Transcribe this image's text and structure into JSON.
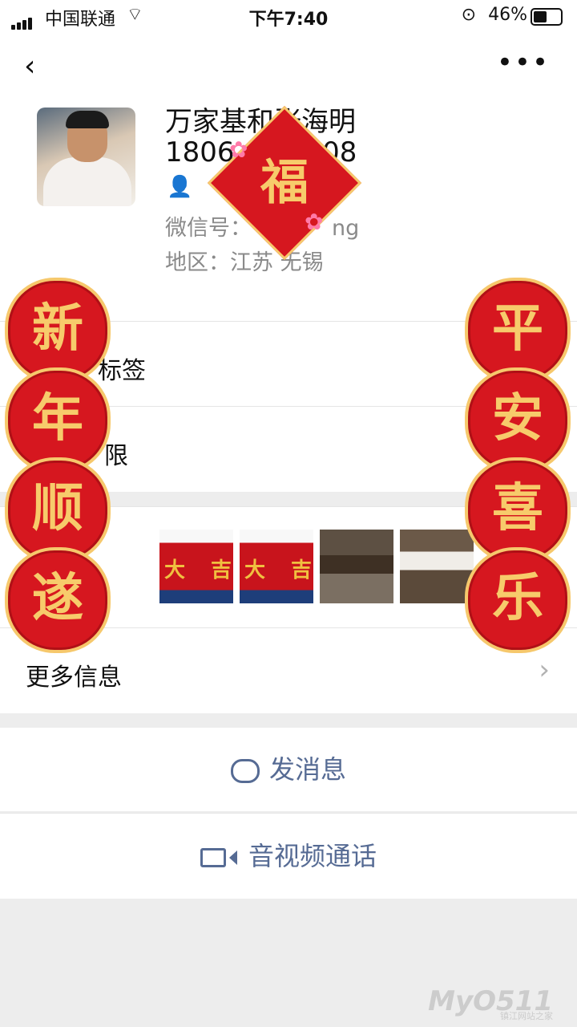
{
  "status_bar": {
    "carrier": "中国联通",
    "time": "下午7:40",
    "battery": "46%"
  },
  "profile": {
    "name": "万家基和张海明",
    "phone_partial_left": "1806",
    "phone_partial_right": "108",
    "wechat_id_label": "微信号：",
    "wechat_id_partial": "ng",
    "region_label": "地区：",
    "region_value": "江苏 无锡"
  },
  "rows": {
    "tags_label": "标签",
    "permissions_label": "限",
    "more_info_label": "更多信息"
  },
  "actions": {
    "send_message": "发消息",
    "call": "音视频通话"
  },
  "decor": {
    "left_badges": [
      "新",
      "年",
      "顺",
      "遂"
    ],
    "right_badges": [
      "平",
      "安",
      "喜",
      "乐"
    ],
    "fu_char": "福"
  },
  "photo_text": "大",
  "photo_text2": "吉",
  "watermark": {
    "main": "MyO511",
    "sub": "镇江网站之家"
  },
  "colors": {
    "accent": "#566b94",
    "badge_red": "#d6171f",
    "badge_gold": "#f6c86c"
  }
}
